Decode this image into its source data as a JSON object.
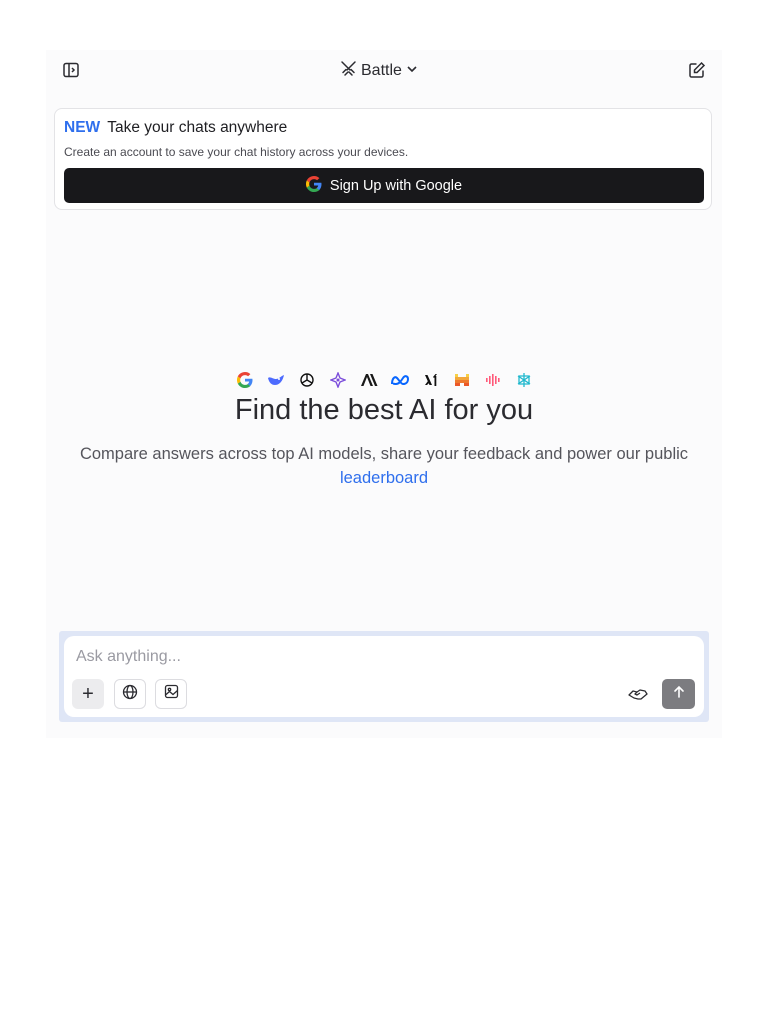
{
  "header": {
    "mode_label": "Battle",
    "icons": [
      "sidebar-toggle-icon",
      "swords-icon",
      "chevron-down-icon",
      "edit-icon"
    ]
  },
  "banner": {
    "badge": "NEW",
    "title": "Take your chats anywhere",
    "subtitle": "Create an account to save your chat history across your devices.",
    "button_label": "Sign Up with Google"
  },
  "model_logos": [
    "google",
    "deepseek",
    "openai",
    "gemini",
    "anthropic",
    "meta",
    "xai",
    "mistral",
    "cohere",
    "perplexity"
  ],
  "hero": {
    "title": "Find the best AI for you",
    "subtitle_prefix": "Compare answers across top AI models, share your feedback and power our public",
    "link_text": "leaderboard"
  },
  "composer": {
    "placeholder": "Ask anything...",
    "plus_label": "+"
  },
  "colors": {
    "accent": "#2f6fed",
    "button_dark": "#18181b",
    "send_gray": "#7c7c80"
  }
}
